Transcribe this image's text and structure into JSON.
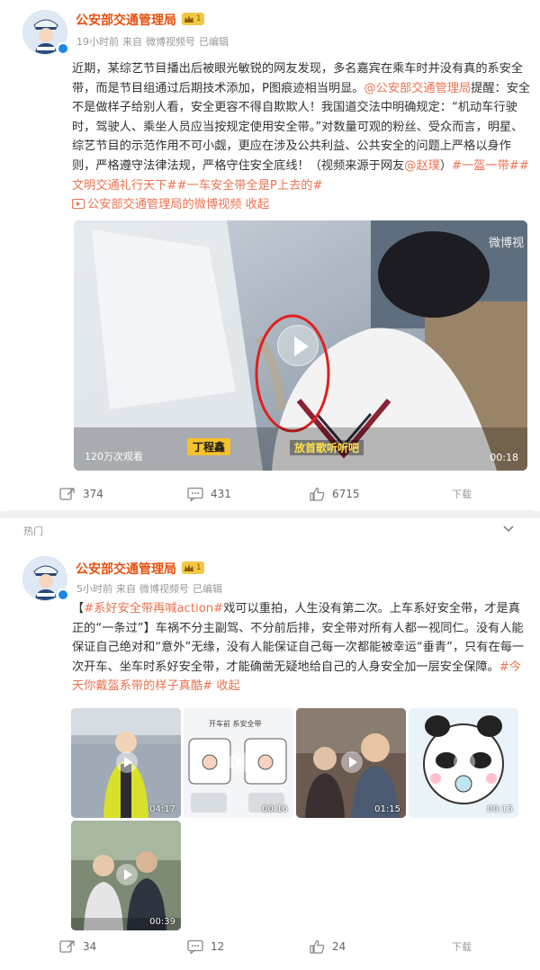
{
  "post1": {
    "author": "公安部交通管理局",
    "level_badge": "1",
    "meta": {
      "time": "19小时前",
      "source": "来自",
      "channel": "微博视频号",
      "edited": "已编辑"
    },
    "text": {
      "p1": "近期，某综艺节目播出后被眼光敏锐的网友发现，多名嘉宾在乘车时并没有真的系安全带，而是节目组通过后期技术添加，P图痕迹相当明显。",
      "mention1": "@公安部交通管理局",
      "p2": "提醒：安全不是做样子给别人看，安全更容不得自欺欺人！我国道交法中明确规定：“机动车行驶时，驾驶人、乘坐人员应当按规定使用安全带。”对数量可观的粉丝、受众而言，明星、综艺节目的示范作用不可小觑，更应在涉及公共利益、公共安全的问题上严格以身作则，严格遵守法律法规，严格守住安全底线！（视频来源于网友",
      "mention2": "@赵璞",
      "close_paren": "）",
      "tag1": "#一盔一带#",
      "tag2": "#文明交通礼行天下#",
      "tag3": "#一车安全带全是P上去的#",
      "video_link": "公安部交通管理局的微博视频",
      "collect": "收起"
    },
    "video": {
      "views": "120万次观看",
      "duration": "00:18",
      "watermark": "微博视",
      "caption_name": "丁程鑫",
      "caption_sub": "放首歌听听吧"
    },
    "actions": {
      "repost": "374",
      "comment": "431",
      "like": "6715",
      "download": "下载"
    }
  },
  "post2": {
    "hot_label": "热门",
    "author": "公安部交通管理局",
    "level_badge": "1",
    "meta": {
      "time": "5小时前",
      "source": "来自",
      "channel": "微博视频号",
      "edited": "已编辑"
    },
    "text": {
      "open": "【",
      "tag1": "#系好安全带再喊action#",
      "t1": "戏可以重拍，人生没有第二次。上车系好安全带，才是真正的“一条过”】车祸不分主副驾、不分前后排，安全带对所有人都一视同仁。没有人能保证自己绝对和“意外”无缘，没有人能保证自己每一次都能被幸运“垂青”，只有在每一次开车、坐车时系好安全带，才能确凿无疑地给自己的人身安全加一层安全保障。",
      "tag2": "#今天你戴盔系带的样子真酷#",
      "collect": "收起"
    },
    "thumbs": [
      {
        "duration": "04:17"
      },
      {
        "duration": "00:16",
        "title": "开车前 系安全带"
      },
      {
        "duration": "01:15"
      },
      {
        "duration": "00:15"
      },
      {
        "duration": "00:39"
      }
    ],
    "actions": {
      "repost": "34",
      "comment": "12",
      "like": "24",
      "download": "下载"
    }
  },
  "colors": {
    "accent": "#eb7350",
    "author": "#e8500f",
    "meta": "#999999"
  }
}
